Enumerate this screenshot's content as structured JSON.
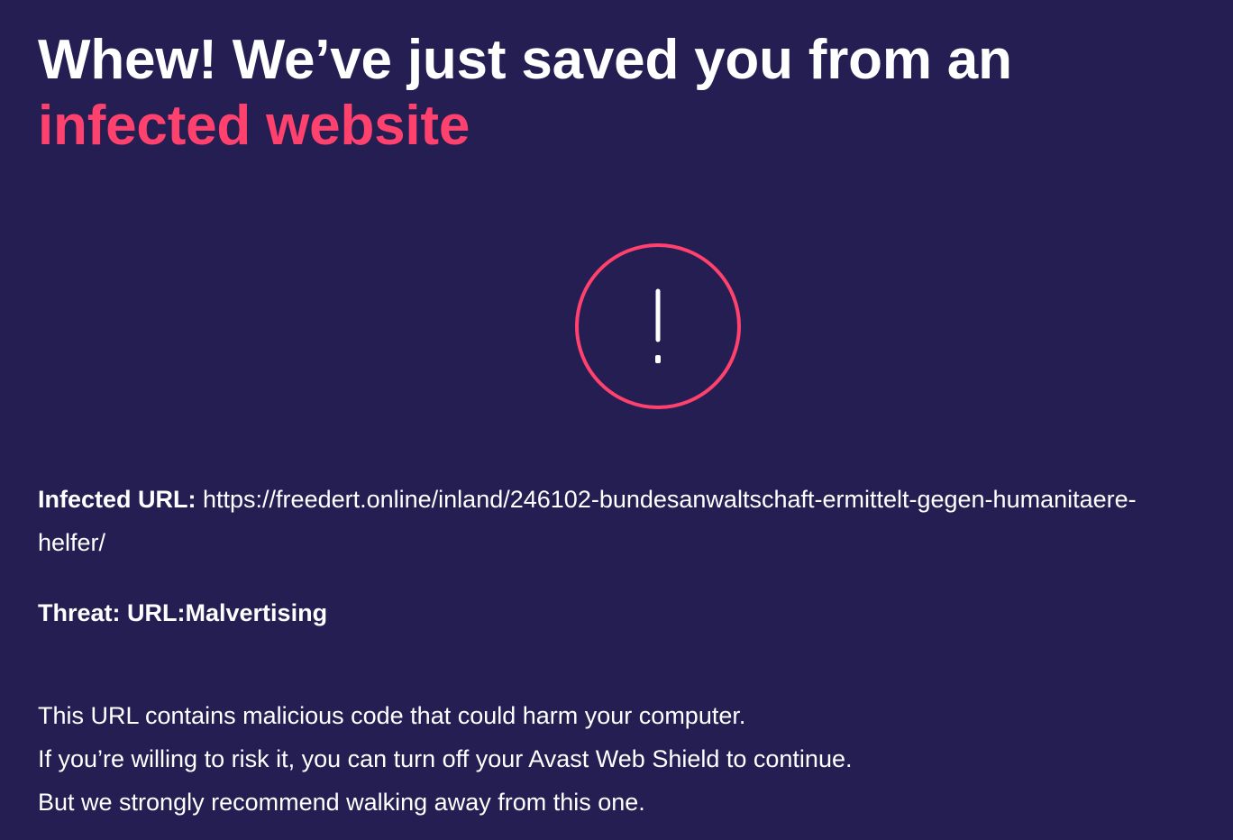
{
  "headline": {
    "line1": "Whew! We’ve just saved you from an",
    "line2": "infected website"
  },
  "icon": "exclamation-icon",
  "colors": {
    "background": "#251e53",
    "accent": "#ff416e",
    "text": "#ffffff"
  },
  "details": {
    "url_label": "Infected URL:",
    "url_value": "https://freedert.online/inland/246102-bundesanwaltschaft-ermittelt-gegen-humanitaere-helfer/",
    "threat_label": "Threat:",
    "threat_value": "URL:Malvertising"
  },
  "message": {
    "line1": "This URL contains malicious code that could harm your computer.",
    "line2": "If you’re willing to risk it, you can turn off your Avast Web Shield to continue.",
    "line3": "But we strongly recommend walking away from this one."
  }
}
